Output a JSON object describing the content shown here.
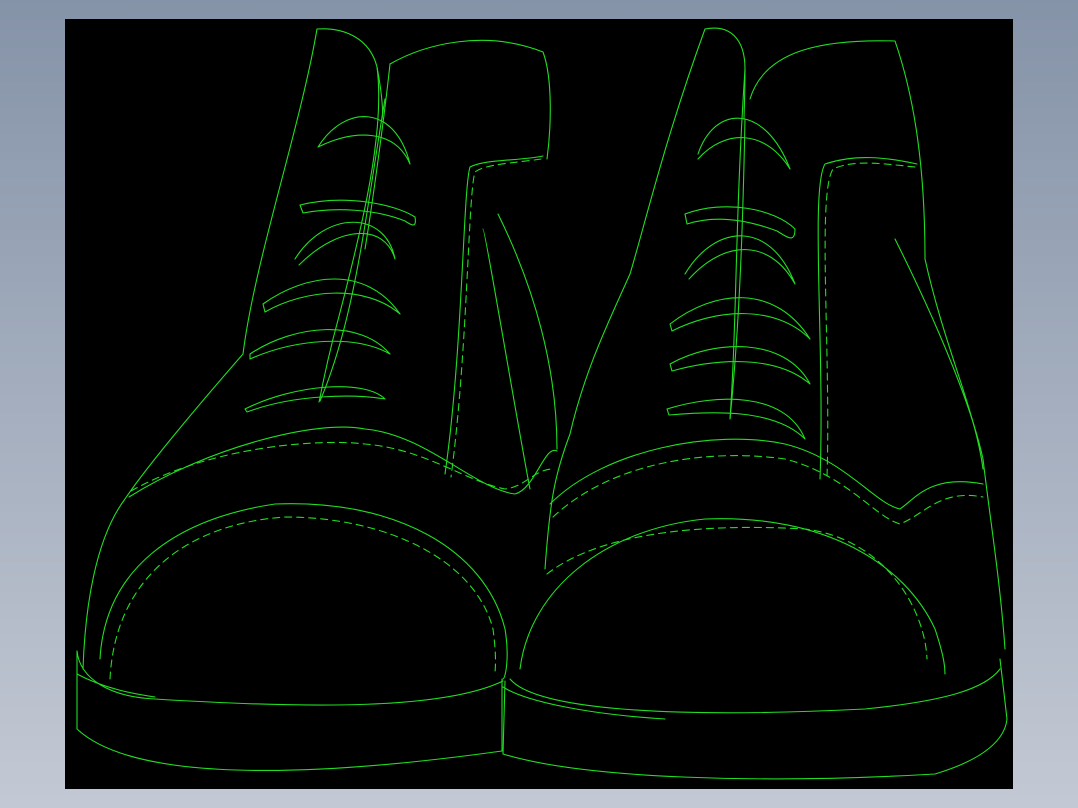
{
  "viewer": {
    "background_top": "#8593a8",
    "background_bottom": "#c3c9d4",
    "canvas_color": "#000000"
  },
  "drawing": {
    "line_color": "#22dd22",
    "subject": "pair-of-lace-up-boots-front-view",
    "objects": [
      "left-boot",
      "right-boot"
    ]
  }
}
